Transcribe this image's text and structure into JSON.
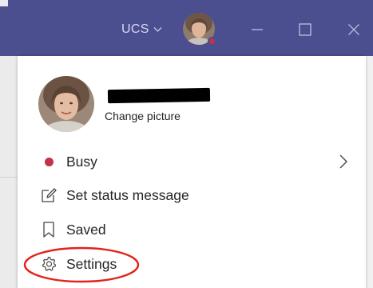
{
  "titlebar": {
    "org_label": "UCS",
    "org_chevron_icon": "chevron-down-icon",
    "presence_color": "#c4314b",
    "background_color": "#4b4f8f",
    "window_controls": [
      "minimize-icon",
      "maximize-icon",
      "close-icon"
    ]
  },
  "profile": {
    "change_picture_label": "Change picture",
    "name_redacted": true
  },
  "menu": {
    "items": [
      {
        "id": "busy",
        "label": "Busy",
        "icon": "presence-dot-icon",
        "icon_color": "#c4314b",
        "has_submenu": true
      },
      {
        "id": "set-status-message",
        "label": "Set status message",
        "icon": "edit-note-icon"
      },
      {
        "id": "saved",
        "label": "Saved",
        "icon": "bookmark-icon"
      },
      {
        "id": "settings",
        "label": "Settings",
        "icon": "gear-icon"
      }
    ]
  },
  "annotation": {
    "highlight_color": "#e2231a",
    "highlighted_item": "settings"
  }
}
